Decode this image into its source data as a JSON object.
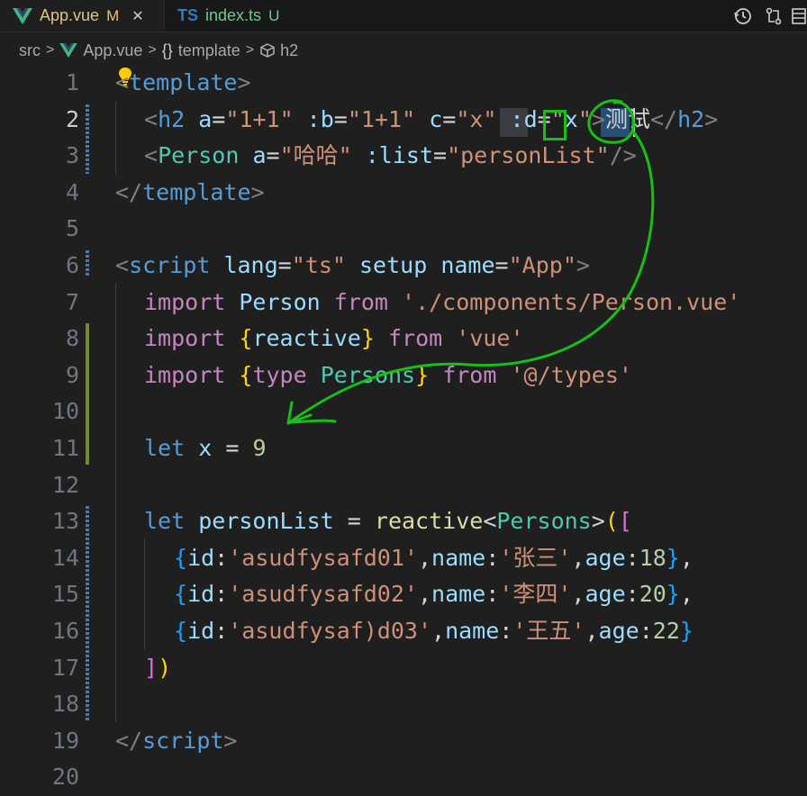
{
  "tabs": [
    {
      "name": "App.vue",
      "badge": "M",
      "active": true
    },
    {
      "name": "index.ts",
      "badge": "U",
      "active": false,
      "icon_text": "TS"
    }
  ],
  "breadcrumb": {
    "items": [
      "src",
      "App.vue",
      "template",
      "h2"
    ],
    "template_glyph": "{}"
  },
  "editor": {
    "line_numbers": [
      "1",
      "2",
      "3",
      "4",
      "5",
      "6",
      "7",
      "8",
      "9",
      "10",
      "11",
      "12",
      "13",
      "14",
      "15",
      "16",
      "17",
      "18",
      "19",
      "20"
    ],
    "current_line": "2",
    "lines": {
      "l1": [
        "<",
        "template",
        ">"
      ],
      "l2": [
        "<",
        "h2",
        " ",
        "a",
        "=",
        "\"1+1\"",
        " :",
        "b",
        "=",
        "\"1+1\"",
        " ",
        "c",
        "=",
        "\"x\"",
        " :",
        "d",
        "=",
        "\"",
        "x",
        "\"",
        ">",
        "测试",
        "</",
        "h2",
        ">"
      ],
      "l3": [
        "<",
        "Person",
        " ",
        "a",
        "=",
        "\"哈哈\"",
        " :",
        "list",
        "=",
        "\"personList\"",
        "/>"
      ],
      "l4": [
        "</",
        "template",
        ">"
      ],
      "l6": [
        "<",
        "script",
        " ",
        "lang",
        "=",
        "\"ts\"",
        " ",
        "setup",
        " ",
        "name",
        "=",
        "\"App\"",
        ">"
      ],
      "l7": [
        "import",
        " ",
        "Person",
        " ",
        "from",
        " ",
        "'./components/Person.vue'"
      ],
      "l8": [
        "import",
        " ",
        "{",
        "reactive",
        "}",
        " ",
        "from",
        " ",
        "'vue'"
      ],
      "l9": [
        "import",
        " ",
        "{",
        "type",
        " ",
        "Persons",
        "}",
        " ",
        "from",
        " ",
        "'@/types'"
      ],
      "l11": [
        "let",
        " ",
        "x",
        " = ",
        "9"
      ],
      "l13": [
        "let",
        " ",
        "personList",
        " = ",
        "reactive",
        "<",
        "Persons",
        ">",
        "(",
        "["
      ],
      "l14": [
        "{",
        "id",
        ":",
        "'asudfysafd01'",
        ",",
        "name",
        ":",
        "'张三'",
        ",",
        "age",
        ":",
        "18",
        "}",
        ","
      ],
      "l15": [
        "{",
        "id",
        ":",
        "'asudfysafd02'",
        ",",
        "name",
        ":",
        "'李四'",
        ",",
        "age",
        ":",
        "20",
        "}",
        ","
      ],
      "l16": [
        "{",
        "id",
        ":",
        "'asudfysaf)d03'",
        ",",
        "name",
        ":",
        "'王五'",
        ",",
        "age",
        ":",
        "22",
        "}"
      ],
      "l17": [
        "]",
        ")"
      ],
      "l19": [
        "</",
        "script",
        ">"
      ]
    }
  },
  "colors": {
    "background": "#1f1f1f",
    "annotation": "#17c017",
    "modified_gutter": "#6f8b2c"
  }
}
